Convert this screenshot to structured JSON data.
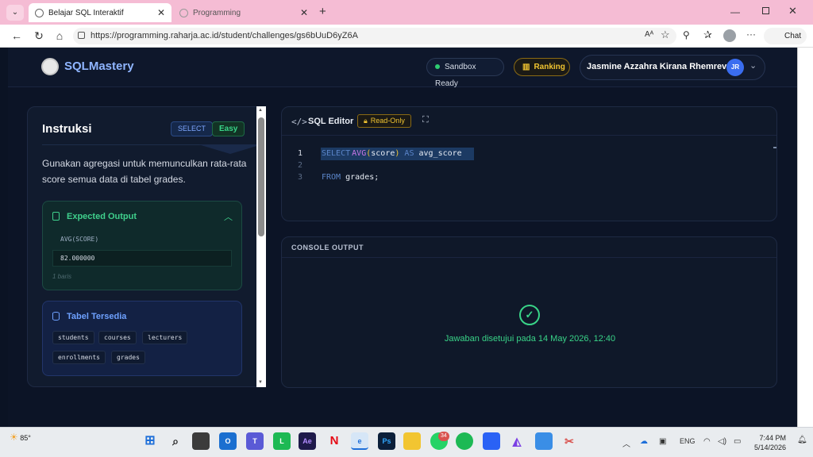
{
  "browser": {
    "tabs": [
      {
        "label": "Belajar SQL Interaktif",
        "active": true
      },
      {
        "label": "Programming",
        "active": false
      }
    ],
    "url": "https://programming.raharja.ac.id/student/challenges/gs6bUuD6yZ6A",
    "chat_label": "Chat",
    "tab_bar_color": "#f5bcd4"
  },
  "app": {
    "brand": "SQLMastery",
    "sandbox_label": "Sandbox Ready",
    "ranking_label": "Ranking",
    "user_name": "Jasmine Azzahra Kirana Rhemrev",
    "user_initials": "JR",
    "accent": "#3a6df0",
    "success_color": "#39d488",
    "warning_color": "#f2c531"
  },
  "instructions": {
    "title": "Instruksi",
    "badge_type": "SELECT",
    "badge_level": "Easy",
    "text": "Gunakan agregasi untuk memunculkan rata-rata score semua data di tabel grades.",
    "expected_output": {
      "title": "Expected Output",
      "column": "AVG(SCORE)",
      "value": "82.000000",
      "row_count": "1 baris"
    },
    "tables": {
      "title": "Tabel Tersedia",
      "items": [
        "students",
        "courses",
        "lecturers",
        "enrollments",
        "grades"
      ]
    }
  },
  "editor": {
    "title": "SQL Editor",
    "mode_badge": "Read-Only",
    "line_numbers": [
      "1",
      "2",
      "3"
    ],
    "line1": {
      "kw1": "SELECT",
      "fn": "AVG",
      "p_open": "(",
      "arg": "score",
      "p_close": ")",
      "kw2": "AS",
      "alias": "avg_score"
    },
    "line3": {
      "kw": "FROM",
      "rest": "grades;"
    }
  },
  "console": {
    "title": "CONSOLE OUTPUT",
    "message": "Jawaban disetujui pada 14 May 2026, 12:40"
  },
  "taskbar": {
    "weather": "85°",
    "language": "ENG",
    "time": "7:44 PM",
    "date": "5/14/2026",
    "whatsapp_badge": "34"
  }
}
